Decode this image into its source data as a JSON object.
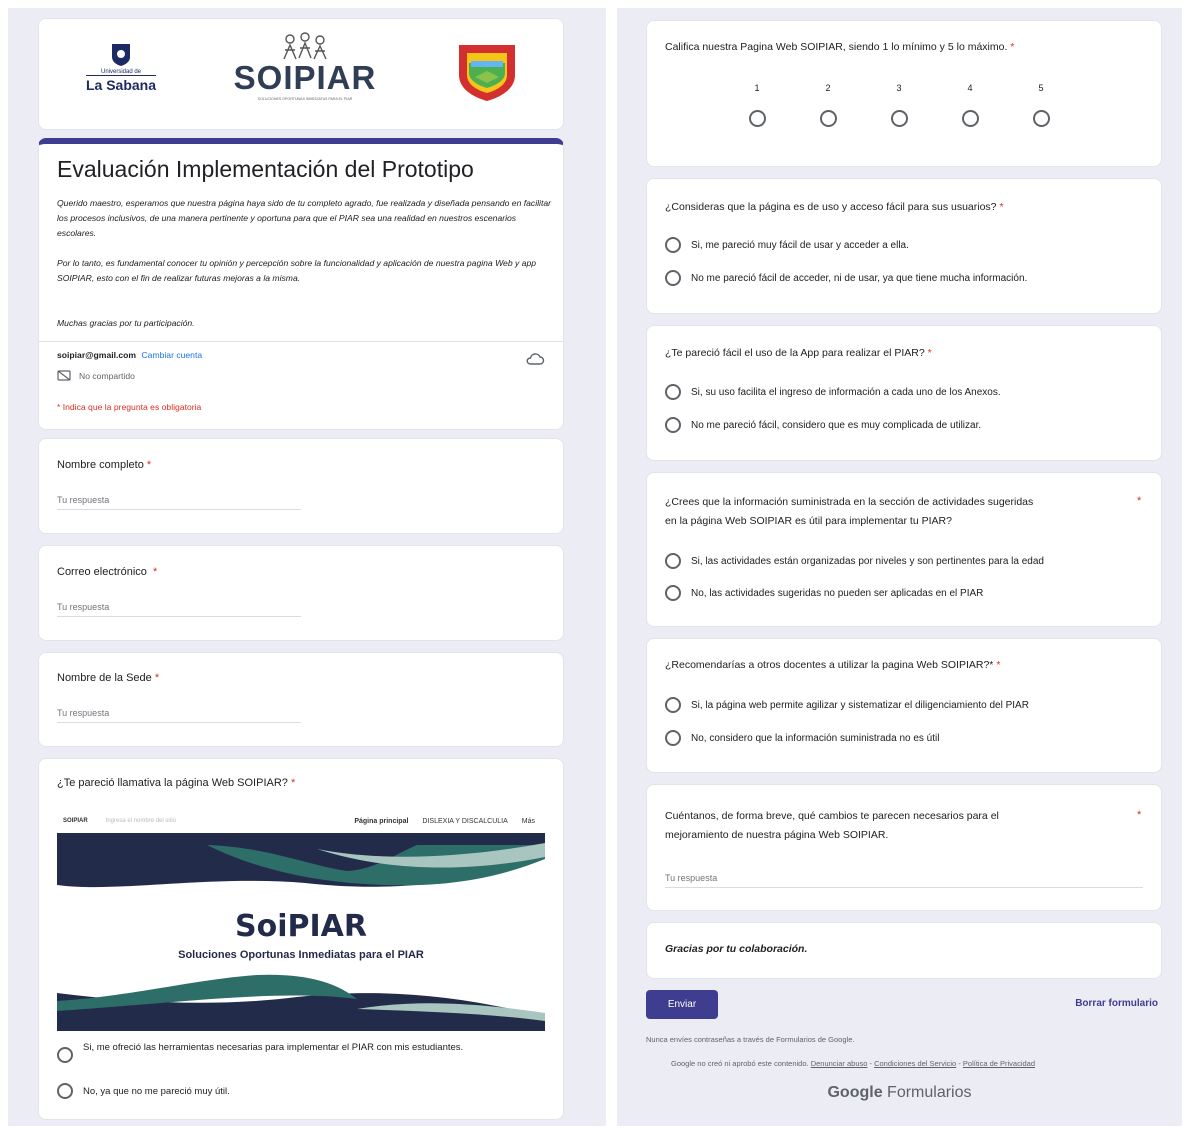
{
  "header": {
    "logo_left_line1": "Universidad de",
    "logo_left_line2": "La Sabana",
    "brand": "SOIPIAR",
    "brand_tagline": "SOLUCIONES OPORTUNAS INMEDIATAS PARA EL PIAR"
  },
  "intro": {
    "title": "Evaluación Implementación del Prototipo",
    "p1": "Querido maestro, esperamos que nuestra página haya sido de tu completo agrado, fue realizada y diseñada pensando en facilitar los procesos inclusivos, de una manera pertinente y oportuna para que el PIAR sea una realidad en nuestros escenarios escolares.",
    "p2": "Por lo tanto, es fundamental conocer tu opinión y percepción sobre la funcionalidad y aplicación de nuestra pagina Web y app SOIPIAR, esto con el fin de realizar futuras mejoras a la misma.",
    "p3": "Muchas gracias por tu participación.",
    "account_email": "soipiar@gmail.com",
    "switch_account": "Cambiar cuenta",
    "not_shared": "No compartido",
    "required_note": "* Indica que la pregunta es obligatoria"
  },
  "questions": {
    "name": {
      "label": "Nombre completo",
      "placeholder": "Tu respuesta"
    },
    "email": {
      "label": "Correo electrónico",
      "placeholder": "Tu respuesta"
    },
    "site": {
      "label": "Nombre de la Sede",
      "placeholder": "Tu respuesta"
    },
    "attractive": {
      "label": "¿Te pareció llamativa la página Web SOIPIAR?",
      "options": [
        "Si, me ofreció las herramientas necesarias para implementar el PIAR con mis estudiantes.",
        "No, ya que no me pareció muy útil."
      ]
    },
    "rating": {
      "label": "Califica nuestra Pagina Web SOIPIAR, siendo 1 lo mínimo y 5 lo máximo.",
      "scale": [
        "1",
        "2",
        "3",
        "4",
        "5"
      ]
    },
    "easy_site": {
      "label": "¿Consideras que la página es de uso y acceso fácil para sus usuarios?",
      "options": [
        "Si, me pareció muy fácil de usar y acceder a ella.",
        "No me pareció fácil de acceder, ni de usar, ya que tiene mucha información."
      ]
    },
    "easy_app": {
      "label": "¿Te pareció fácil el uso de la App para realizar el PIAR?",
      "options": [
        "Si,  su uso facilita el ingreso de información a cada uno de los Anexos.",
        "No me pareció fácil, considero que es muy complicada de utilizar."
      ]
    },
    "activities": {
      "label1": "¿Crees que la información suministrada en la sección de actividades sugeridas",
      "label2": "en la página Web SOIPIAR es útil para implementar tu PIAR?",
      "options": [
        "Si, las actividades están organizadas por niveles y son pertinentes para la edad",
        "No, las actividades sugeridas no pueden ser aplicadas en el PIAR"
      ]
    },
    "recommend": {
      "label": "¿Recomendarías a otros docentes a utilizar la pagina Web SOIPIAR?*",
      "options": [
        "Si, la página web permite agilizar y sistematizar el diligenciamiento del PIAR",
        "No, considero que la información suministrada no es útil"
      ]
    },
    "changes": {
      "label1": "Cuéntanos, de forma breve, qué cambios te parecen necesarios para el",
      "label2": "mejoramiento de nuestra página Web SOIPIAR.",
      "placeholder": "Tu respuesta"
    }
  },
  "preview": {
    "brand": "SOIPIAR",
    "search_placeholder": "Ingresa el nombre del sitio",
    "nav": [
      "Página principal",
      "DISLEXIA Y DISCALCULIA",
      "Más"
    ],
    "title": "SoiPIAR",
    "subtitle": "Soluciones Oportunas Inmediatas para el PIAR"
  },
  "footer": {
    "thanks": "Gracias por tu colaboración.",
    "submit": "Enviar",
    "clear": "Borrar formulario",
    "warning": "Nunca envíes contraseñas a través de Formularios de Google.",
    "disclaimer": "Google no creó ni aprobó este contenido.",
    "report": "Denunciar abuso",
    "terms": "Condiciones del Servicio",
    "privacy": "Política de Privacidad",
    "brand_google": "Google",
    "brand_forms": "Formularios"
  },
  "colors": {
    "accent": "#3f3d8f",
    "required": "#d93025",
    "link": "#1a73e8",
    "background": "#ecedf4",
    "preview_dark": "#232b4a",
    "preview_teal": "#2e6e68"
  }
}
